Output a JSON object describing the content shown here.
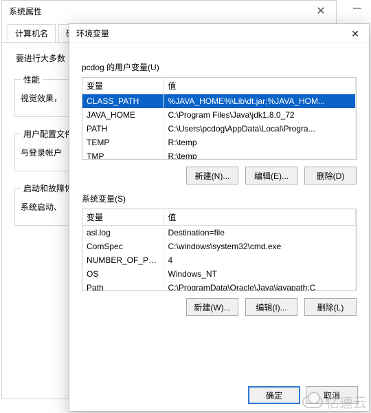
{
  "back_dialog": {
    "title": "系统属性",
    "close": "✕",
    "tabs": [
      "计算机名",
      "硬件"
    ],
    "desc": "要进行大多数",
    "fs1_legend": "性能",
    "fs1_text": "视觉效果，",
    "fs2_legend": "用户配置文件",
    "fs2_text": "与登录帐户",
    "fs3_legend": "启动和故障恢",
    "fs3_text": "系统启动、"
  },
  "front_dialog": {
    "title": "环境变量",
    "close": "✕",
    "user_section_label": "pcdog 的用户变量(U)",
    "user_cols": {
      "name": "变量",
      "value": "值"
    },
    "user_rows": [
      {
        "name": "CLASS_PATH",
        "value": "%JAVA_HOME%\\Lib\\dt.jar;%JAVA_HOM...",
        "selected": true
      },
      {
        "name": "JAVA_HOME",
        "value": "C:\\Program Files\\Java\\jdk1.8.0_72"
      },
      {
        "name": "PATH",
        "value": "C:\\Users\\pcdog\\AppData\\Local\\Progra..."
      },
      {
        "name": "TEMP",
        "value": "R:\\temp"
      },
      {
        "name": "TMP",
        "value": "R:\\temp"
      }
    ],
    "user_buttons": {
      "new": "新建(N)...",
      "edit": "编辑(E)...",
      "delete": "删除(D)"
    },
    "sys_section_label": "系统变量(S)",
    "sys_cols": {
      "name": "变量",
      "value": "值"
    },
    "sys_rows": [
      {
        "name": "asl.log",
        "value": "Destination=file"
      },
      {
        "name": "ComSpec",
        "value": "C:\\windows\\system32\\cmd.exe"
      },
      {
        "name": "NUMBER_OF_PR...",
        "value": "4"
      },
      {
        "name": "OS",
        "value": "Windows_NT"
      },
      {
        "name": "Path",
        "value": "C:\\ProgramData\\Oracle\\Java\\javapath;C"
      }
    ],
    "sys_buttons": {
      "new": "新建(W)...",
      "edit": "编辑(I)...",
      "delete": "删除(L)"
    },
    "footer": {
      "ok": "确定",
      "cancel": "取消"
    }
  },
  "watermark": "亿速云",
  "chrome": {
    "min": "—",
    "max": "□"
  }
}
